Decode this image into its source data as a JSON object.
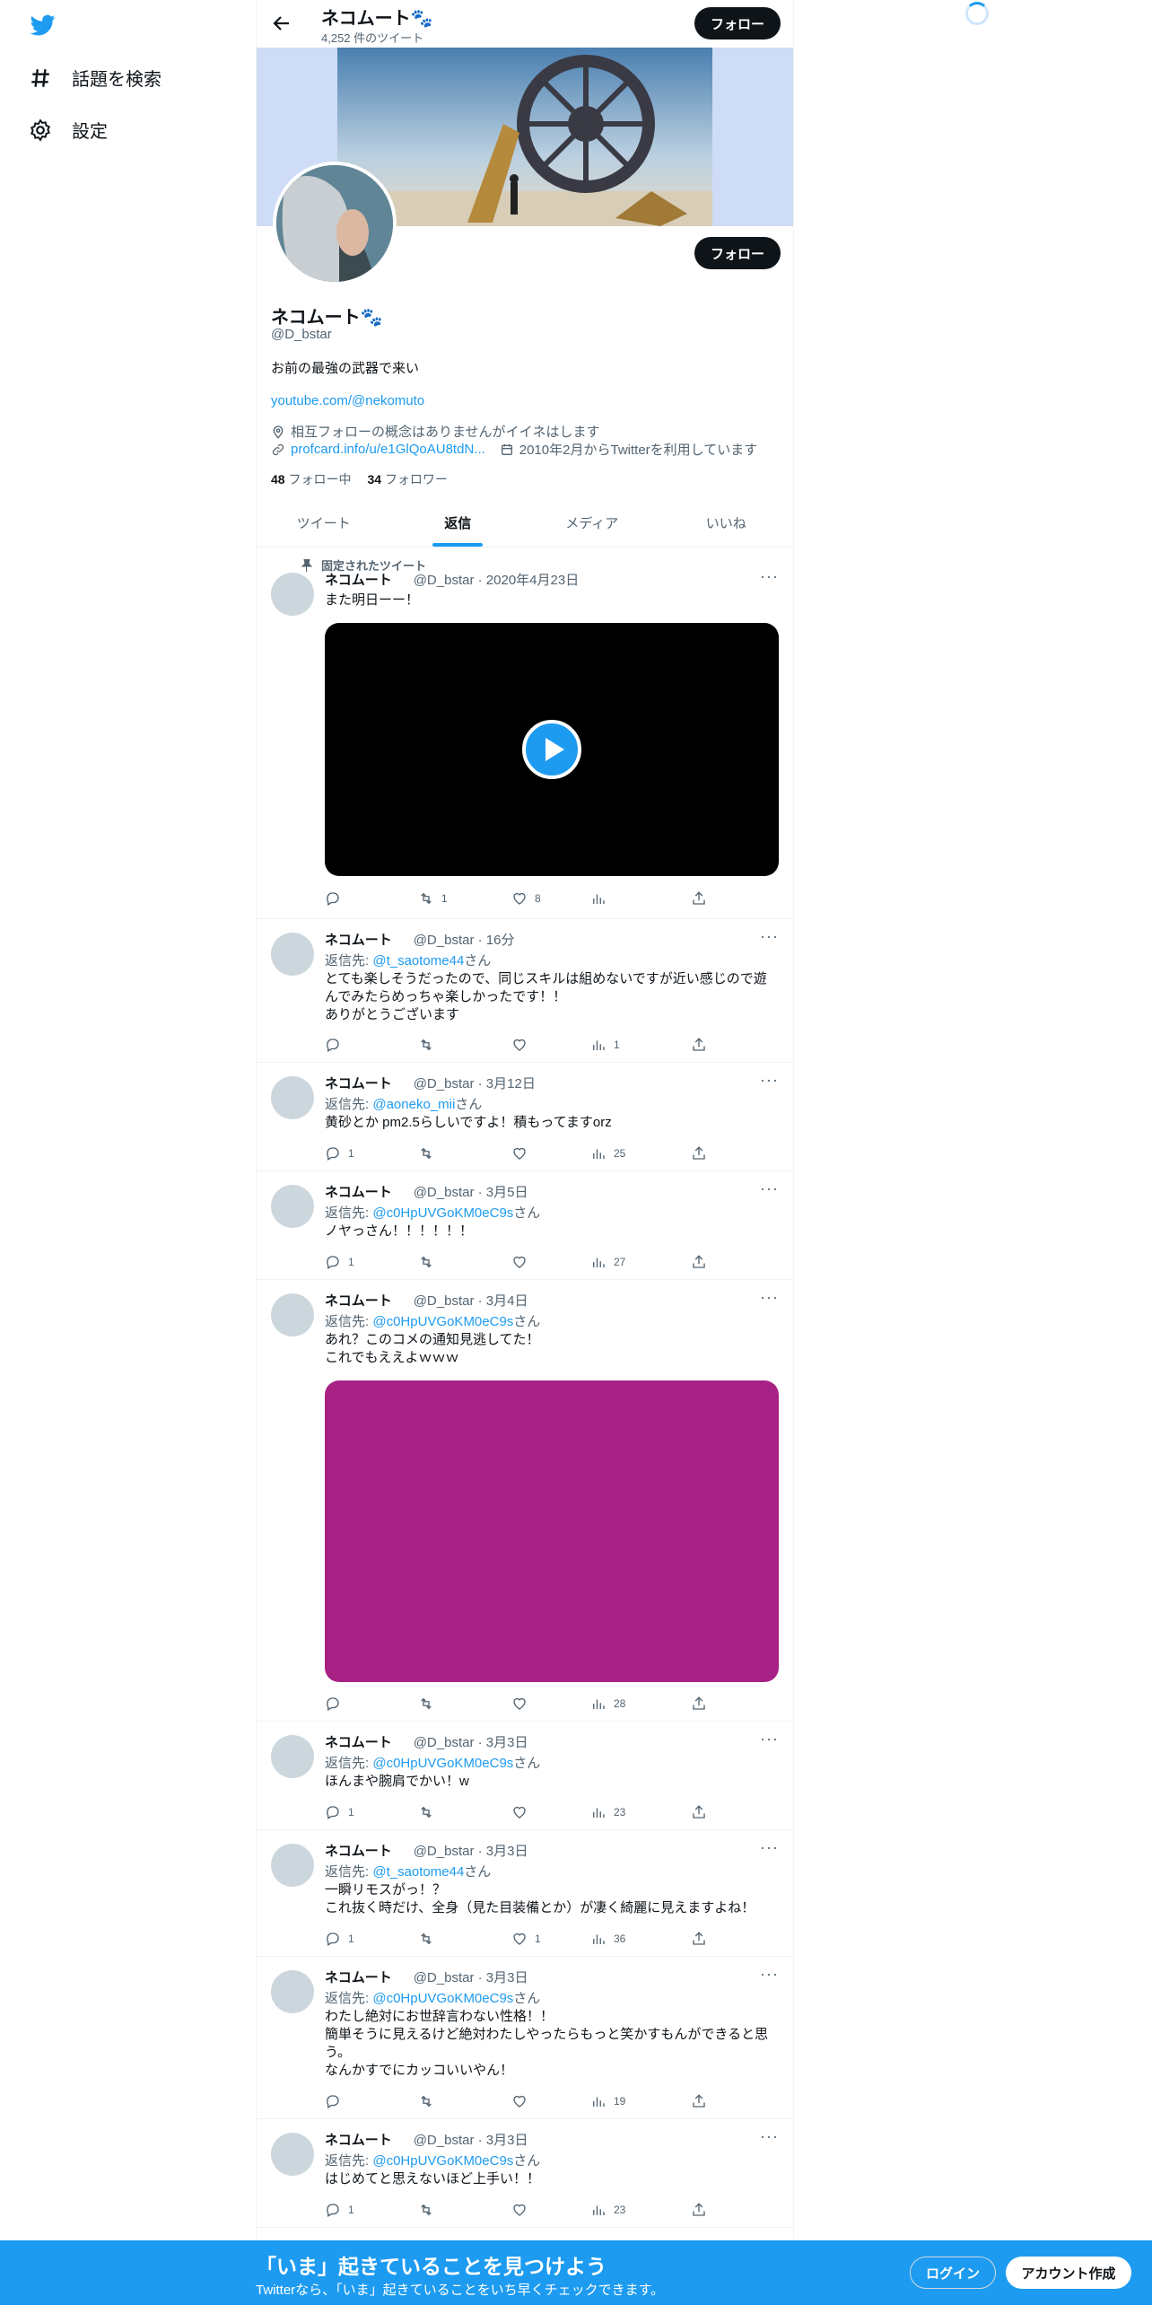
{
  "nav": {
    "explore_label": "話題を検索",
    "settings_label": "設定"
  },
  "header": {
    "name": "ネコムート🐾",
    "tweet_count": "4,252 件のツイート",
    "follow_label": "フォロー"
  },
  "profile": {
    "name": "ネコムート🐾",
    "handle": "@D_bstar",
    "bio": "お前の最強の武器で来い",
    "link": "youtube.com/@nekomuto",
    "location": "相互フォローの概念はありませんがイイネはします",
    "url": "profcard.info/u/e1GlQoAU8tdN...",
    "joined": "2010年2月からTwitterを利用しています",
    "following_count": "48",
    "following_label": "フォロー中",
    "followers_count": "34",
    "followers_label": "フォロワー",
    "follow_label": "フォロー"
  },
  "tabs": [
    {
      "label": "ツイート"
    },
    {
      "label": "返信"
    },
    {
      "label": "メディア"
    },
    {
      "label": "いいね"
    }
  ],
  "pinned_label": "固定されたツイート",
  "tweets": [
    {
      "name": "ネコムート",
      "handle": "@D_bstar",
      "time": "2020年4月23日",
      "reply_to": "",
      "text": "また明日ーー！",
      "replies": "",
      "retweets": "1",
      "likes": "8",
      "views": ""
    },
    {
      "name": "ネコムート",
      "handle": "@D_bstar",
      "time": "16分",
      "reply_prefix": "返信先: ",
      "reply_to": "@t_saotome44",
      "reply_suffix": "さん",
      "text": "とても楽しそうだったので、同じスキルは組めないですが近い感じので遊\nんでみたらめっちゃ楽しかったです！！\nありがとうございます",
      "replies": "",
      "retweets": "",
      "likes": "",
      "views": "1"
    },
    {
      "name": "ネコムート",
      "handle": "@D_bstar",
      "time": "3月12日",
      "reply_prefix": "返信先: ",
      "reply_to": "@aoneko_mii",
      "reply_suffix": "さん",
      "text": "黄砂とか pm2.5らしいですよ！積もってますorz",
      "replies": "1",
      "retweets": "",
      "likes": "",
      "views": "25"
    },
    {
      "name": "ネコムート",
      "handle": "@D_bstar",
      "time": "3月5日",
      "reply_prefix": "返信先: ",
      "reply_to": "@c0HpUVGoKM0eC9s",
      "reply_suffix": "さん",
      "text": "ノヤっさん！！！！！！",
      "replies": "1",
      "retweets": "",
      "likes": "",
      "views": "27"
    },
    {
      "name": "ネコムート",
      "handle": "@D_bstar",
      "time": "3月4日",
      "reply_prefix": "返信先: ",
      "reply_to": "@c0HpUVGoKM0eC9s",
      "reply_suffix": "さん",
      "text": "あれ？このコメの通知見逃してた！\nこれでもええよｗｗｗ",
      "replies": "",
      "retweets": "",
      "likes": "",
      "views": "28"
    },
    {
      "name": "ネコムート",
      "handle": "@D_bstar",
      "time": "3月3日",
      "reply_prefix": "返信先: ",
      "reply_to": "@c0HpUVGoKM0eC9s",
      "reply_suffix": "さん",
      "text": "ほんまや腕肩でかい！w",
      "replies": "1",
      "retweets": "",
      "likes": "",
      "views": "23"
    },
    {
      "name": "ネコムート",
      "handle": "@D_bstar",
      "time": "3月3日",
      "reply_prefix": "返信先: ",
      "reply_to": "@t_saotome44",
      "reply_suffix": "さん",
      "text": "一瞬リモスがっ！？\nこれ抜く時だけ、全身（見た目装備とか）が凄く綺麗に見えますよね！",
      "replies": "1",
      "retweets": "",
      "likes": "1",
      "views": "36"
    },
    {
      "name": "ネコムート",
      "handle": "@D_bstar",
      "time": "3月3日",
      "reply_prefix": "返信先: ",
      "reply_to": "@c0HpUVGoKM0eC9s",
      "reply_suffix": "さん",
      "text": "わたし絶対にお世辞言わない性格！！\n簡単そうに見えるけど絶対わたしやったらもっと笑かすもんができると思\nう。\nなんかすでにカッコいいやん！",
      "replies": "",
      "retweets": "",
      "likes": "",
      "views": "19"
    },
    {
      "name": "ネコムート",
      "handle": "@D_bstar",
      "time": "3月3日",
      "reply_prefix": "返信先: ",
      "reply_to": "@c0HpUVGoKM0eC9s",
      "reply_suffix": "さん",
      "text": "はじめてと思えないほど上手い！！",
      "replies": "1",
      "retweets": "",
      "likes": "",
      "views": "23"
    }
  ],
  "bottom": {
    "title": "「いま」起きていることを見つけよう",
    "subtitle": "Twitterなら、「いま」起きていることをいち早くチェックできます。",
    "login_label": "ログイン",
    "signup_label": "アカウント作成"
  },
  "colors": {
    "accent": "#1d9bf0",
    "media_magenta": "#a82184",
    "video_bg": "#000000"
  }
}
